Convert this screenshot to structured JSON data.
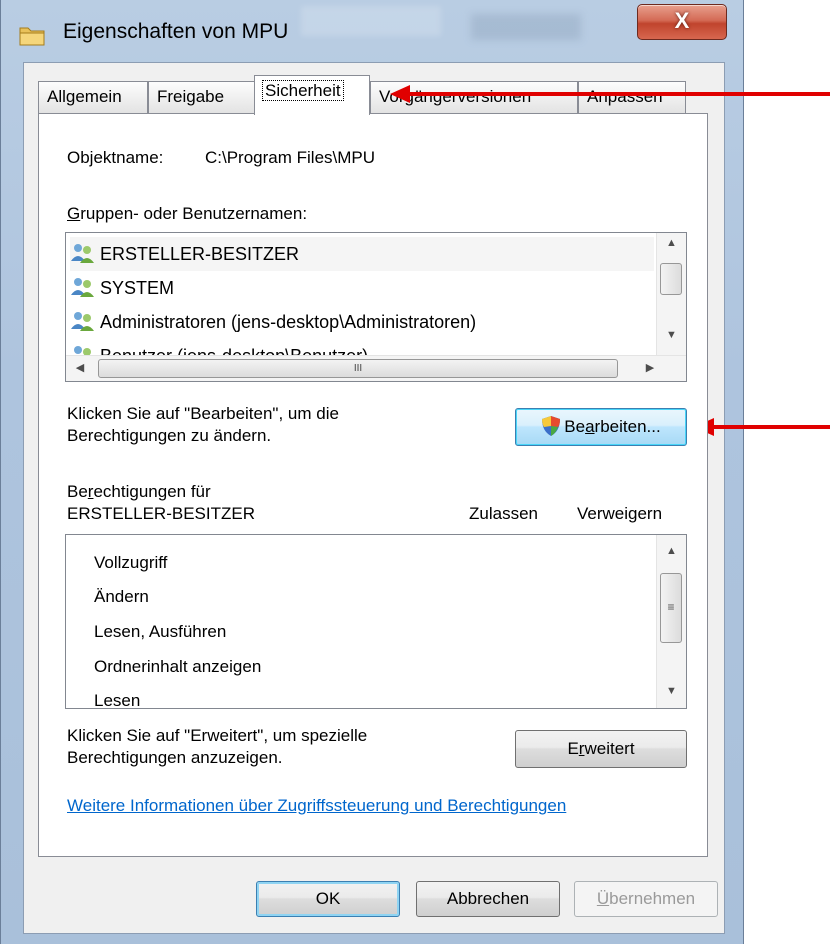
{
  "window": {
    "title": "Eigenschaften von MPU",
    "close_glyph": "X"
  },
  "tabs": [
    {
      "label": "Allgemein"
    },
    {
      "label": "Freigabe"
    },
    {
      "label": "Sicherheit"
    },
    {
      "label": "Vorgängerversionen"
    },
    {
      "label": "Anpassen"
    }
  ],
  "security": {
    "object_label": "Objektname:",
    "object_value": "C:\\Program Files\\MPU",
    "groups_label_prefix": "G",
    "groups_label_rest": "ruppen- oder Benutzernamen:",
    "users": [
      {
        "name": "ERSTELLER-BESITZER",
        "icon": "user-group-icon"
      },
      {
        "name": "SYSTEM",
        "icon": "user-group-icon"
      },
      {
        "name": "Administratoren (jens-desktop\\Administratoren)",
        "icon": "user-group-icon"
      },
      {
        "name": "Benutzer (jens-desktop\\Benutzer)",
        "icon": "user-group-icon"
      }
    ],
    "scroll_grip": "III",
    "edit_hint_line1": "Klicken Sie auf \"Bearbeiten\", um die",
    "edit_hint_line2": "Berechtigungen zu ändern.",
    "edit_button": {
      "pre": "Be",
      "mnemonic": "a",
      "post": "rbeiten..."
    },
    "perm_for_line1_pre": "Be",
    "perm_for_line1_mnemonic": "r",
    "perm_for_line1_post": "echtigungen für",
    "perm_for_line2": "ERSTELLER-BESITZER",
    "col_allow": "Zulassen",
    "col_deny": "Verweigern",
    "permissions": [
      "Vollzugriff",
      "Ändern",
      "Lesen, Ausführen",
      "Ordnerinhalt anzeigen",
      "Lesen"
    ],
    "advanced_hint_line1": "Klicken Sie auf \"Erweitert\", um spezielle",
    "advanced_hint_line2": "Berechtigungen anzuzeigen.",
    "advanced_button": {
      "pre": "E",
      "mnemonic": "r",
      "post": "weitert"
    },
    "more_info_link": "Weitere Informationen über Zugriffssteuerung und Berechtigungen"
  },
  "footer": {
    "ok": "OK",
    "cancel": "Abbrechen",
    "apply_mnemonic": "Ü",
    "apply_rest": "bernehmen"
  },
  "annotations": {
    "color": "#e00000",
    "count": 2
  },
  "colors": {
    "link": "#0066cc",
    "panel_bg": "#ffffff",
    "dialog_bg": "#f0f0f0"
  }
}
